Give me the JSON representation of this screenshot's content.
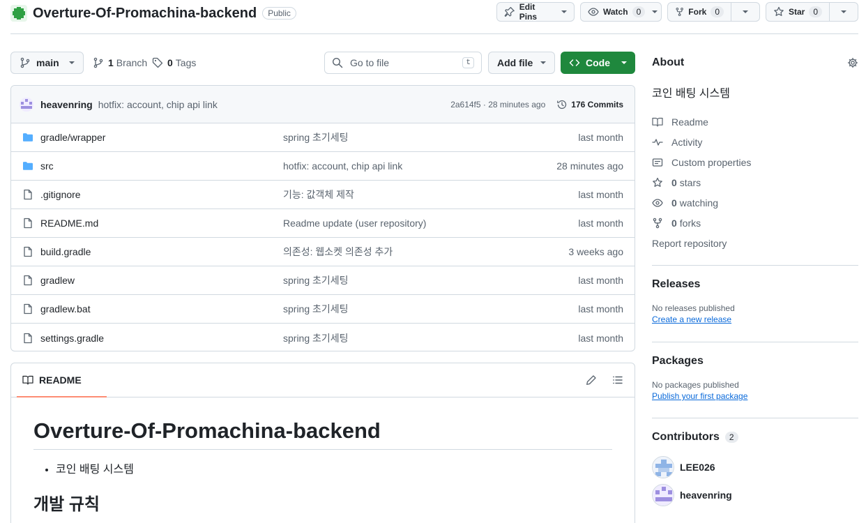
{
  "repo": {
    "name": "Overture-Of-Promachina-backend",
    "visibility": "Public",
    "edit_pins": "Edit Pins",
    "watch": "Watch",
    "watch_count": "0",
    "fork": "Fork",
    "fork_count": "0",
    "star": "Star",
    "star_count": "0"
  },
  "toolbar": {
    "branch": "main",
    "branches_count": "1",
    "branches_label": "Branch",
    "tags_count": "0",
    "tags_label": "Tags",
    "goto_placeholder": "Go to file",
    "goto_key": "t",
    "add_file": "Add file",
    "code": "Code"
  },
  "commit": {
    "author": "heavenring",
    "message": "hotfix: account, chip api link",
    "sha_time": "2a614f5 · 28 minutes ago",
    "commits": "176 Commits"
  },
  "files": [
    {
      "type": "folder",
      "name": "gradle/wrapper",
      "message": "spring 초기세팅",
      "date": "last month"
    },
    {
      "type": "folder",
      "name": "src",
      "message": "hotfix: account, chip api link",
      "date": "28 minutes ago"
    },
    {
      "type": "file",
      "name": ".gitignore",
      "message": "기능: 값객체 제작",
      "date": "last month"
    },
    {
      "type": "file",
      "name": "README.md",
      "message": "Readme update (user repository)",
      "date": "last month"
    },
    {
      "type": "file",
      "name": "build.gradle",
      "message": "의존성: 웹소켓 의존성 추가",
      "date": "3 weeks ago"
    },
    {
      "type": "file",
      "name": "gradlew",
      "message": "spring 초기세팅",
      "date": "last month"
    },
    {
      "type": "file",
      "name": "gradlew.bat",
      "message": "spring 초기세팅",
      "date": "last month"
    },
    {
      "type": "file",
      "name": "settings.gradle",
      "message": "spring 초기세팅",
      "date": "last month"
    }
  ],
  "readme": {
    "tab": "README",
    "title": "Overture-Of-Promachina-backend",
    "bullet": "코인 배팅 시스템",
    "h2": "개발 규칙"
  },
  "about": {
    "title": "About",
    "description": "코인 배팅 시스템",
    "readme": "Readme",
    "activity": "Activity",
    "custom_properties": "Custom properties",
    "stars_count": "0",
    "stars_label": "stars",
    "watching_count": "0",
    "watching_label": "watching",
    "forks_count": "0",
    "forks_label": "forks",
    "report": "Report repository"
  },
  "releases": {
    "title": "Releases",
    "none": "No releases published",
    "link": "Create a new release"
  },
  "packages": {
    "title": "Packages",
    "none": "No packages published",
    "link": "Publish your first package"
  },
  "contributors": {
    "title": "Contributors",
    "count": "2",
    "list": [
      "LEE026",
      "heavenring"
    ]
  },
  "colors": {
    "accent_green": "#1f883d",
    "link_blue": "#0969da",
    "folder_blue": "#54aeff",
    "tab_underline": "#fd8c73"
  }
}
